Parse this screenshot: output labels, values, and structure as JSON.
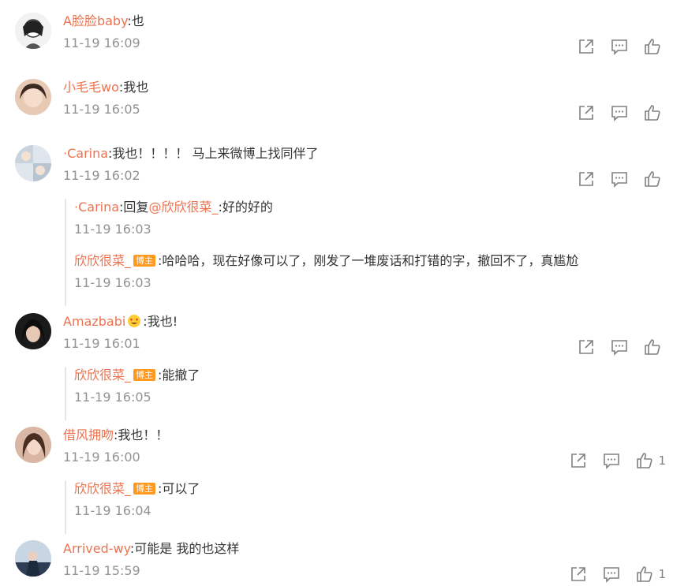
{
  "comments": [
    {
      "user": "A脸脸baby",
      "text": ":也",
      "time": "11-19 16:09",
      "likes": ""
    },
    {
      "user": "小毛毛wo",
      "text": ":我也",
      "time": "11-19 16:05",
      "likes": ""
    },
    {
      "user": "·Carina",
      "text": ":我也！！！！ 马上来微博上找同伴了",
      "time": "11-19 16:02",
      "likes": "",
      "replies": [
        {
          "user": "·Carina",
          "pre": ":回复",
          "mention": "@欣欣很菜_",
          "text": ":好的好的",
          "time": "11-19 16:03"
        },
        {
          "user": "欣欣很菜_",
          "badge": "博主",
          "text": ":哈哈哈，现在好像可以了，刚发了一堆废话和打错的字，撤回不了，真尴尬",
          "time": "11-19 16:03"
        }
      ]
    },
    {
      "user": "Amazbabi",
      "text": ":我也!",
      "time": "11-19 16:01",
      "likes": "",
      "replies": [
        {
          "user": "欣欣很菜_",
          "badge": "博主",
          "text": ":能撤了",
          "time": "11-19 16:05"
        }
      ]
    },
    {
      "user": "借风拥吻",
      "text": ":我也！！",
      "time": "11-19 16:00",
      "likes": "1",
      "replies": [
        {
          "user": "欣欣很菜_",
          "badge": "博主",
          "text": ":可以了",
          "time": "11-19 16:04"
        }
      ]
    },
    {
      "user": "Arrived-wy",
      "text": ":可能是 我的也这样",
      "time": "11-19 15:59",
      "likes": "1"
    }
  ],
  "icons": {
    "share": "share-icon",
    "comment": "comment-icon",
    "like": "like-icon"
  },
  "colors": {
    "username": "#eb7350",
    "time": "#939393",
    "badge": "#ff9a1f"
  }
}
